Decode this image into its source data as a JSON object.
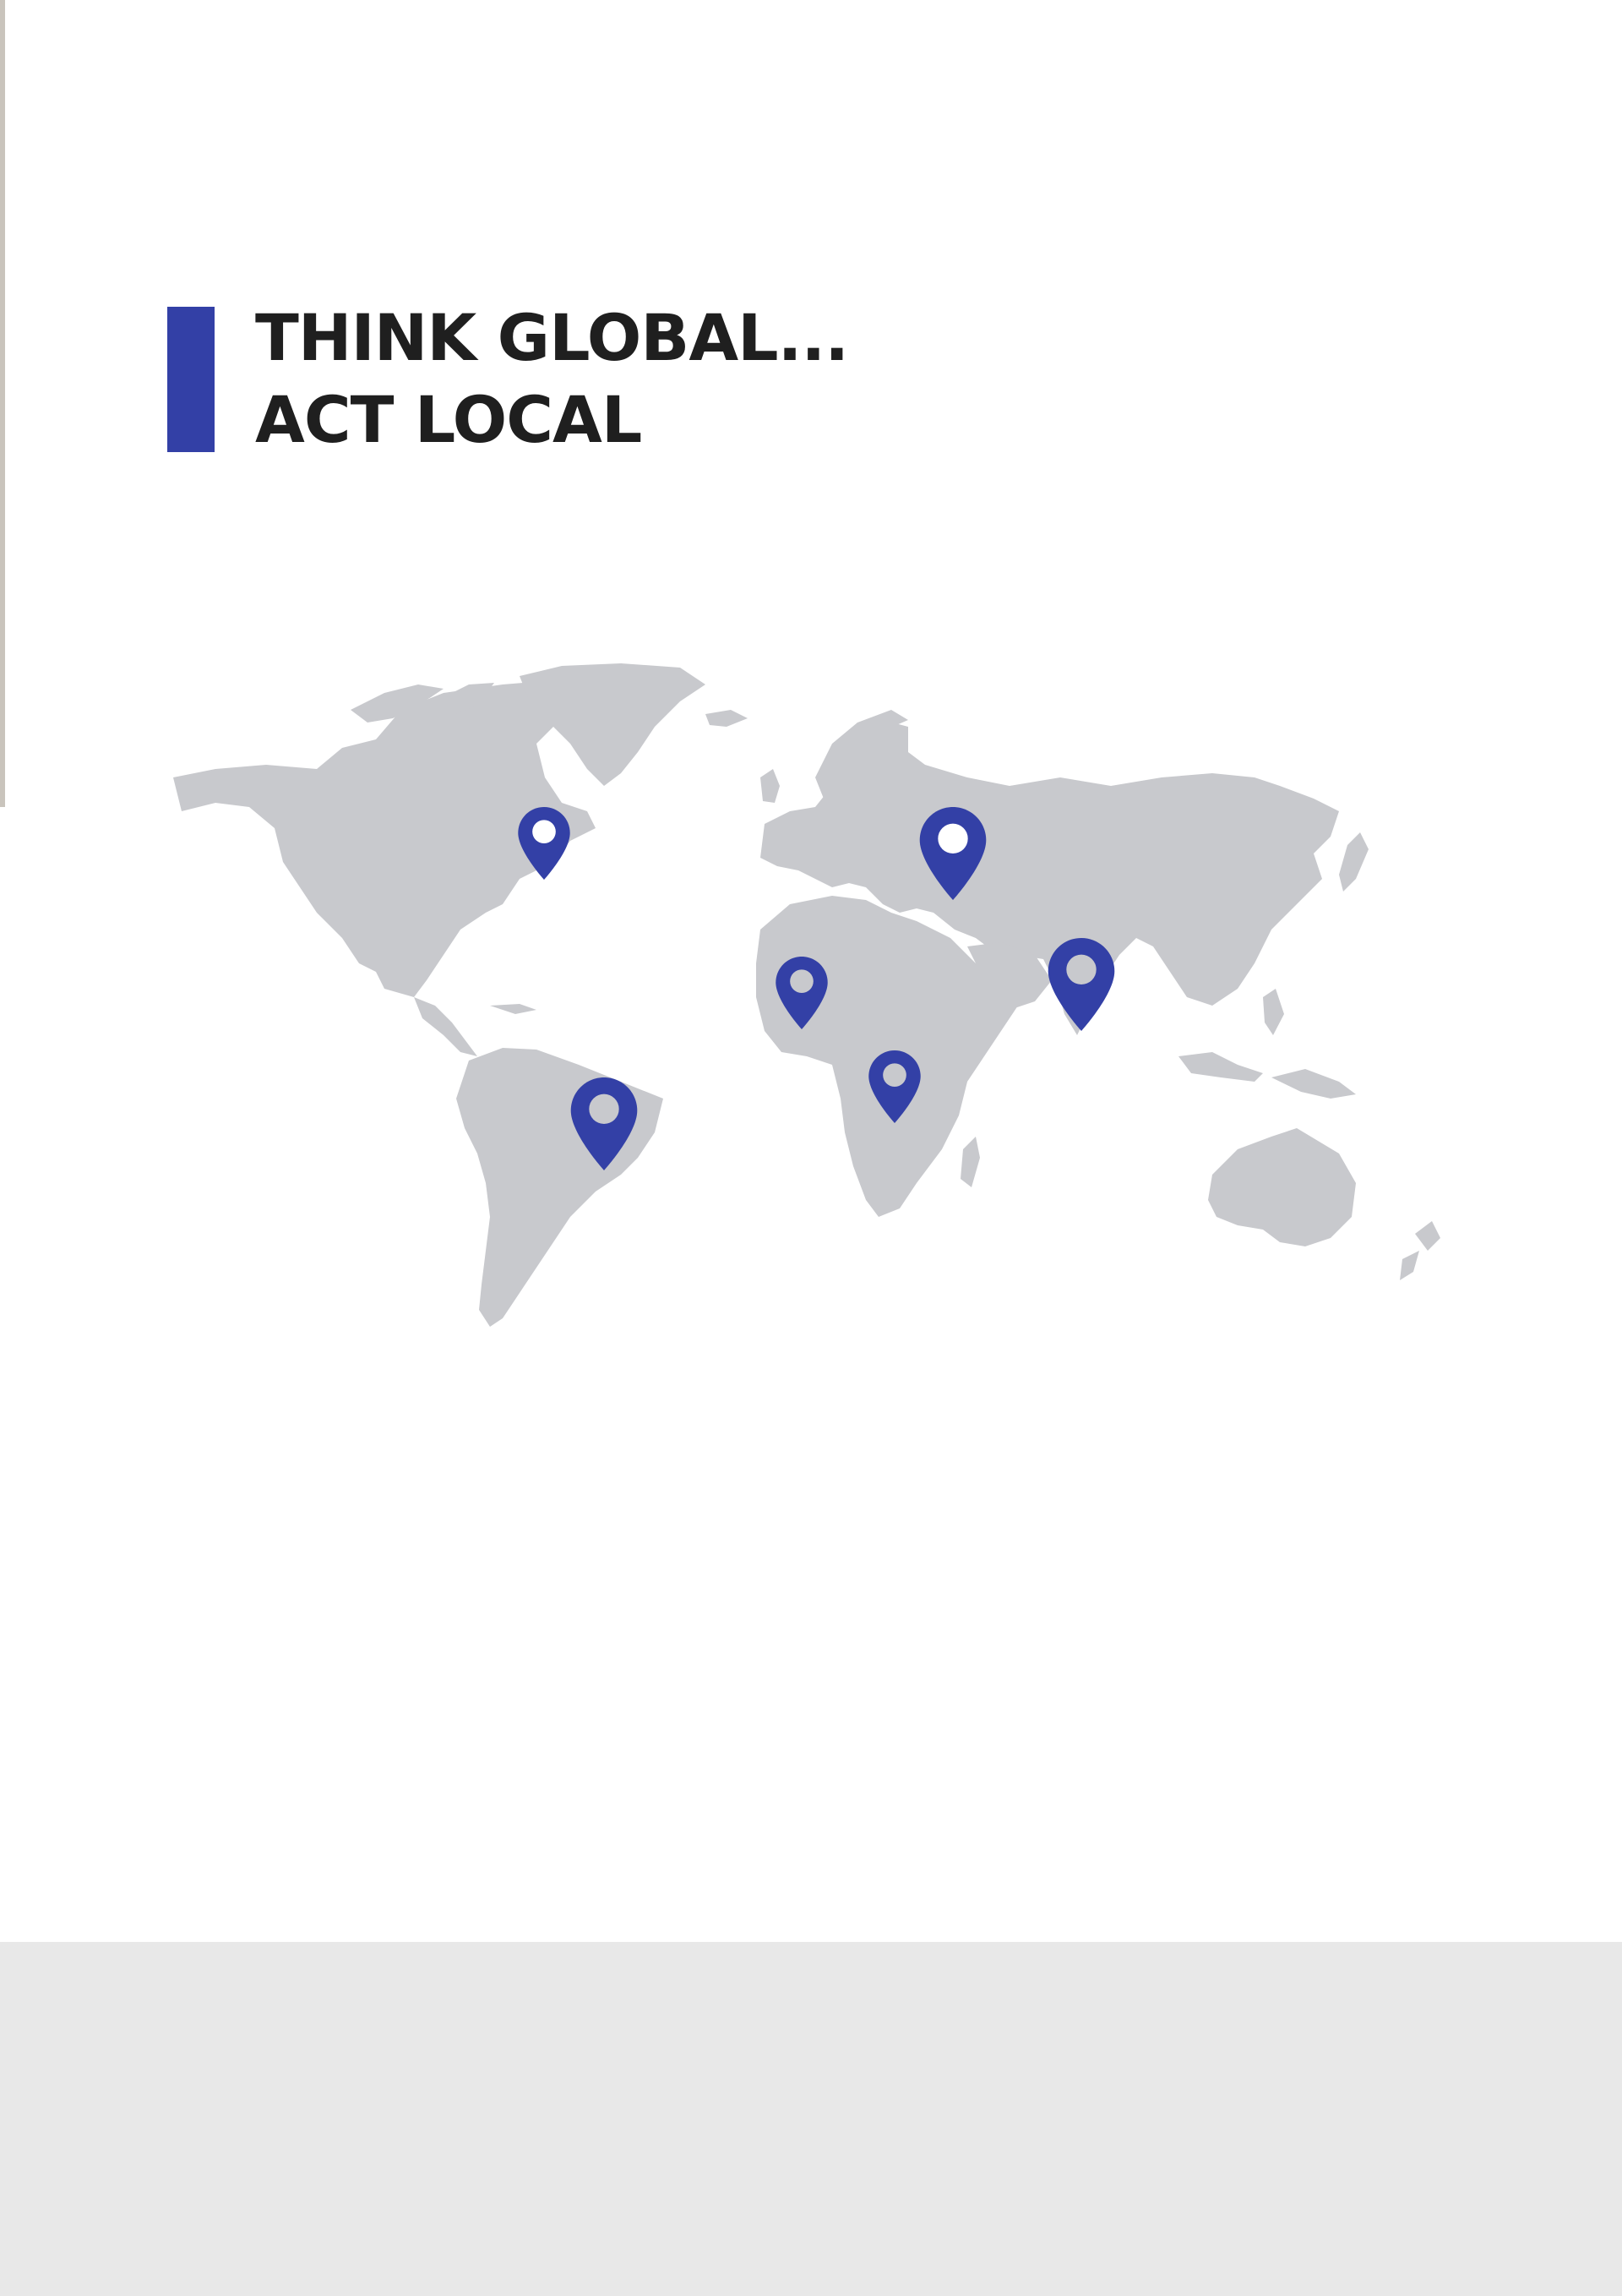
{
  "heading": {
    "line1": "THINK GLOBAL...",
    "line2": "ACT LOCAL"
  },
  "colors": {
    "accent": "#3340a6",
    "land": "#c8c9cd",
    "text": "#1f1f1f",
    "footer": "#e8e8e8"
  },
  "map": {
    "pins": [
      {
        "name": "map-pin-north-america-icon",
        "region": "North America"
      },
      {
        "name": "map-pin-eastern-europe-icon",
        "region": "Eastern Europe"
      },
      {
        "name": "map-pin-north-africa-icon",
        "region": "North Africa"
      },
      {
        "name": "map-pin-south-asia-icon",
        "region": "South Asia"
      },
      {
        "name": "map-pin-east-africa-icon",
        "region": "East Africa"
      },
      {
        "name": "map-pin-south-america-icon",
        "region": "South America"
      }
    ]
  }
}
